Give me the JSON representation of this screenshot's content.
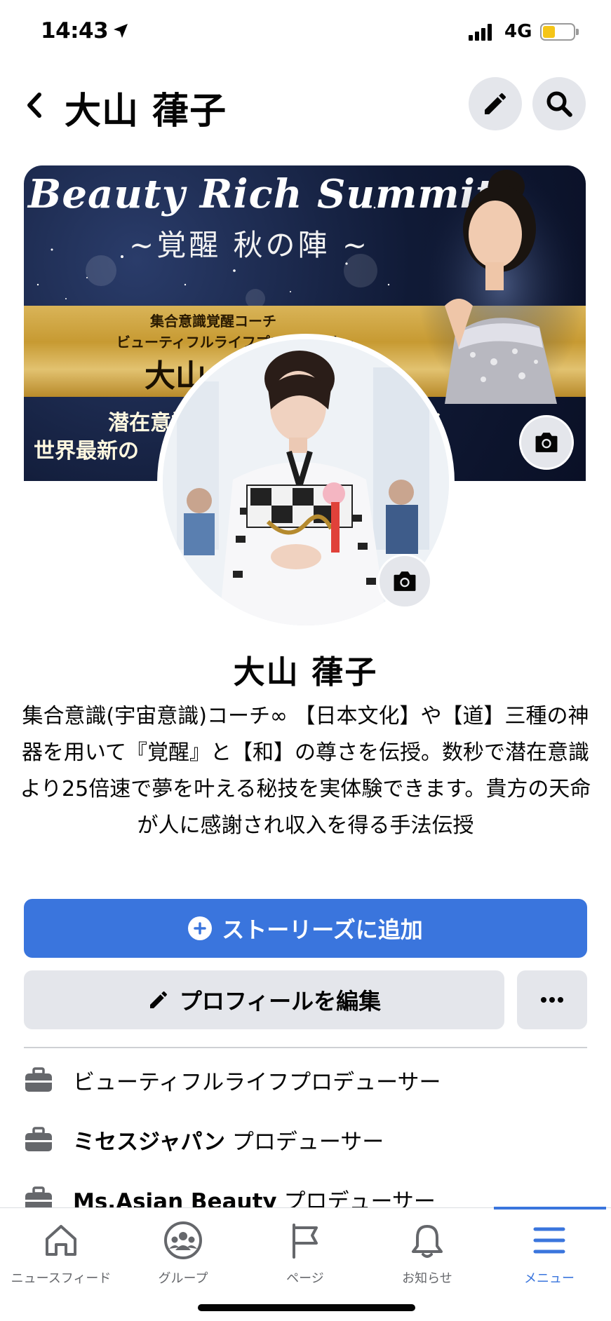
{
  "status_bar": {
    "time": "14:43",
    "network": "4G",
    "battery_level": 0.4
  },
  "header": {
    "title": "大山 葎子"
  },
  "cover": {
    "title": "Beauty Rich Summit",
    "subtitle": "~覚醒 秋の陣 ~",
    "band_line1": "集合意識覚醒コーチ",
    "band_line2": "ビューティフルライフプロデューサー",
    "band_name": "大山",
    "bottom_line1": "潜在意識　　　　　　　　　変わる",
    "bottom_line2": "世界最新の　　　　　　　　　古来から"
  },
  "profile": {
    "name": "大山 葎子",
    "bio": "集合意識(宇宙意識)コーチ∞ 【日本文化】や【道】三種の神器を用いて『覚醒』と【和】の尊さを伝授。数秒で潜在意識より25倍速で夢を叶える秘技を実体験できます。貴方の天命が人に感謝され収入を得る手法伝授"
  },
  "actions": {
    "add_story": "ストーリーズに追加",
    "edit_profile": "プロフィールを編集"
  },
  "work": [
    {
      "bold": "",
      "text": "ビューティフルライフプロデューサー"
    },
    {
      "bold": "ミセスジャパン",
      "text": " プロデューサー"
    },
    {
      "bold": "Ms.Asian Beauty",
      "text": " プロデューサー"
    }
  ],
  "tabs": [
    {
      "label": "ニュースフィード",
      "icon": "home-icon"
    },
    {
      "label": "グループ",
      "icon": "groups-icon"
    },
    {
      "label": "ページ",
      "icon": "flag-icon"
    },
    {
      "label": "お知らせ",
      "icon": "bell-icon"
    },
    {
      "label": "メニュー",
      "icon": "menu-icon",
      "active": true
    }
  ],
  "colors": {
    "accent": "#3a75dd",
    "button_gray": "#e4e6eb",
    "battery": "#f5c518"
  }
}
